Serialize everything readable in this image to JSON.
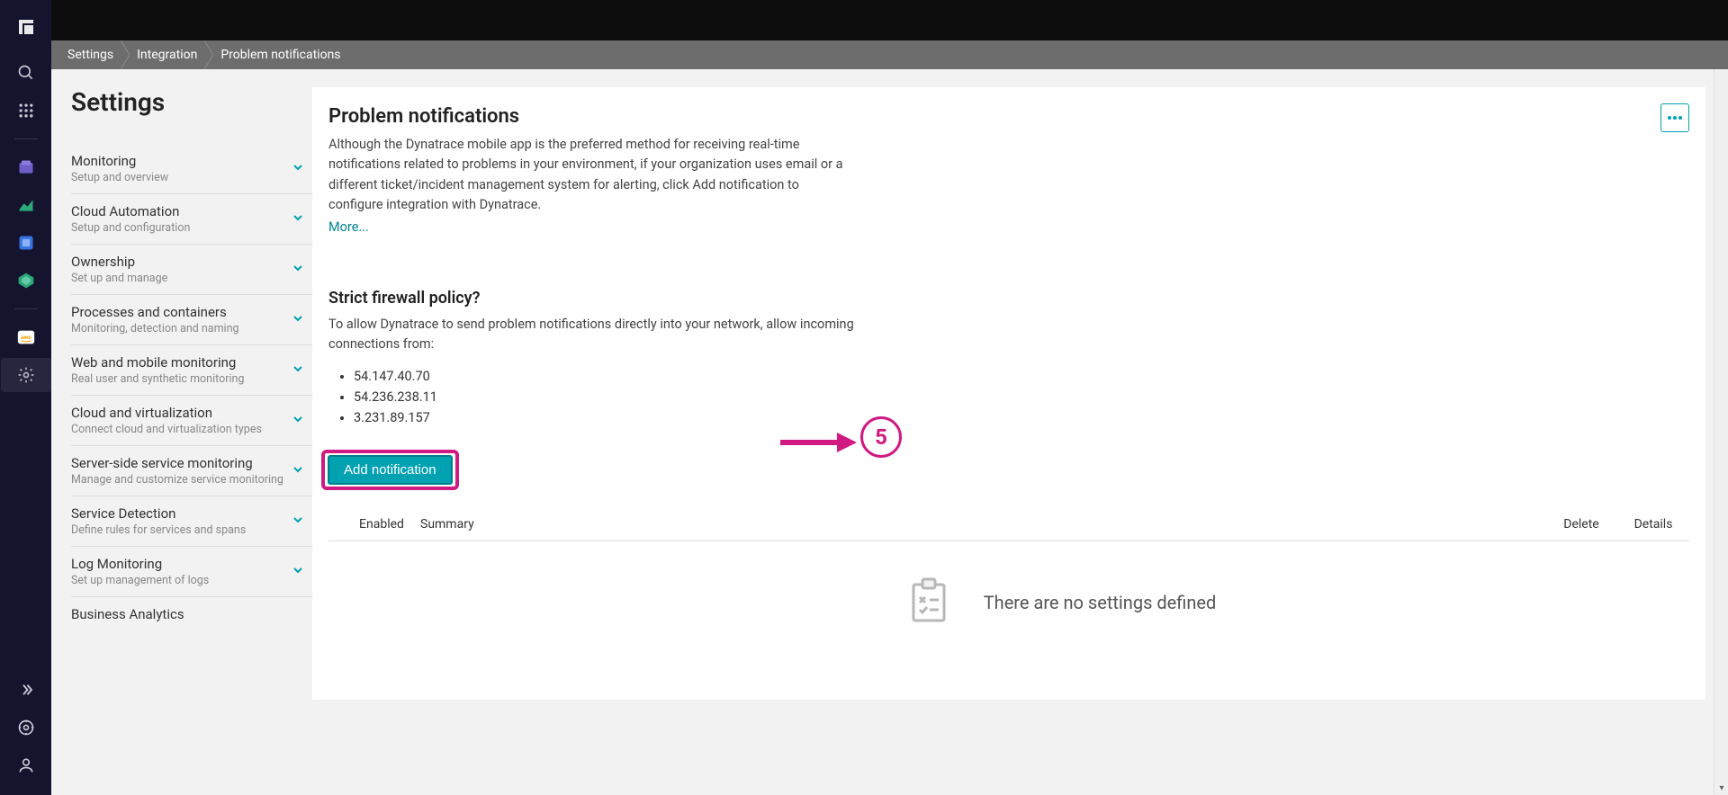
{
  "breadcrumb": {
    "lvl1": "Settings",
    "lvl2": "Integration",
    "lvl3": "Problem notifications"
  },
  "sidebar": {
    "title": "Settings",
    "groups": [
      {
        "title": "Monitoring",
        "sub": "Setup and overview"
      },
      {
        "title": "Cloud Automation",
        "sub": "Setup and configuration"
      },
      {
        "title": "Ownership",
        "sub": "Set up and manage"
      },
      {
        "title": "Processes and containers",
        "sub": "Monitoring, detection and naming"
      },
      {
        "title": "Web and mobile monitoring",
        "sub": "Real user and synthetic monitoring"
      },
      {
        "title": "Cloud and virtualization",
        "sub": "Connect cloud and virtualization types"
      },
      {
        "title": "Server-side service monitoring",
        "sub": "Manage and customize service monitoring"
      },
      {
        "title": "Service Detection",
        "sub": "Define rules for services and spans"
      },
      {
        "title": "Log Monitoring",
        "sub": "Set up management of logs"
      },
      {
        "title": "Business Analytics",
        "sub": ""
      }
    ]
  },
  "main": {
    "title": "Problem notifications",
    "desc": "Although the Dynatrace mobile app is the preferred method for receiving real-time notifications related to problems in your environment, if your organization uses email or a different ticket/incident management system for alerting, click Add notification to configure integration with Dynatrace.",
    "more": "More...",
    "firewall_title": "Strict firewall policy?",
    "firewall_desc": "To allow Dynatrace to send problem notifications directly into your network, allow incoming connections from:",
    "ips": [
      "54.147.40.70",
      "54.236.238.11",
      "3.231.89.157"
    ],
    "add_btn": "Add notification",
    "annotation_number": "5",
    "table": {
      "enabled": "Enabled",
      "summary": "Summary",
      "delete": "Delete",
      "details": "Details"
    },
    "empty": "There are no settings defined"
  }
}
